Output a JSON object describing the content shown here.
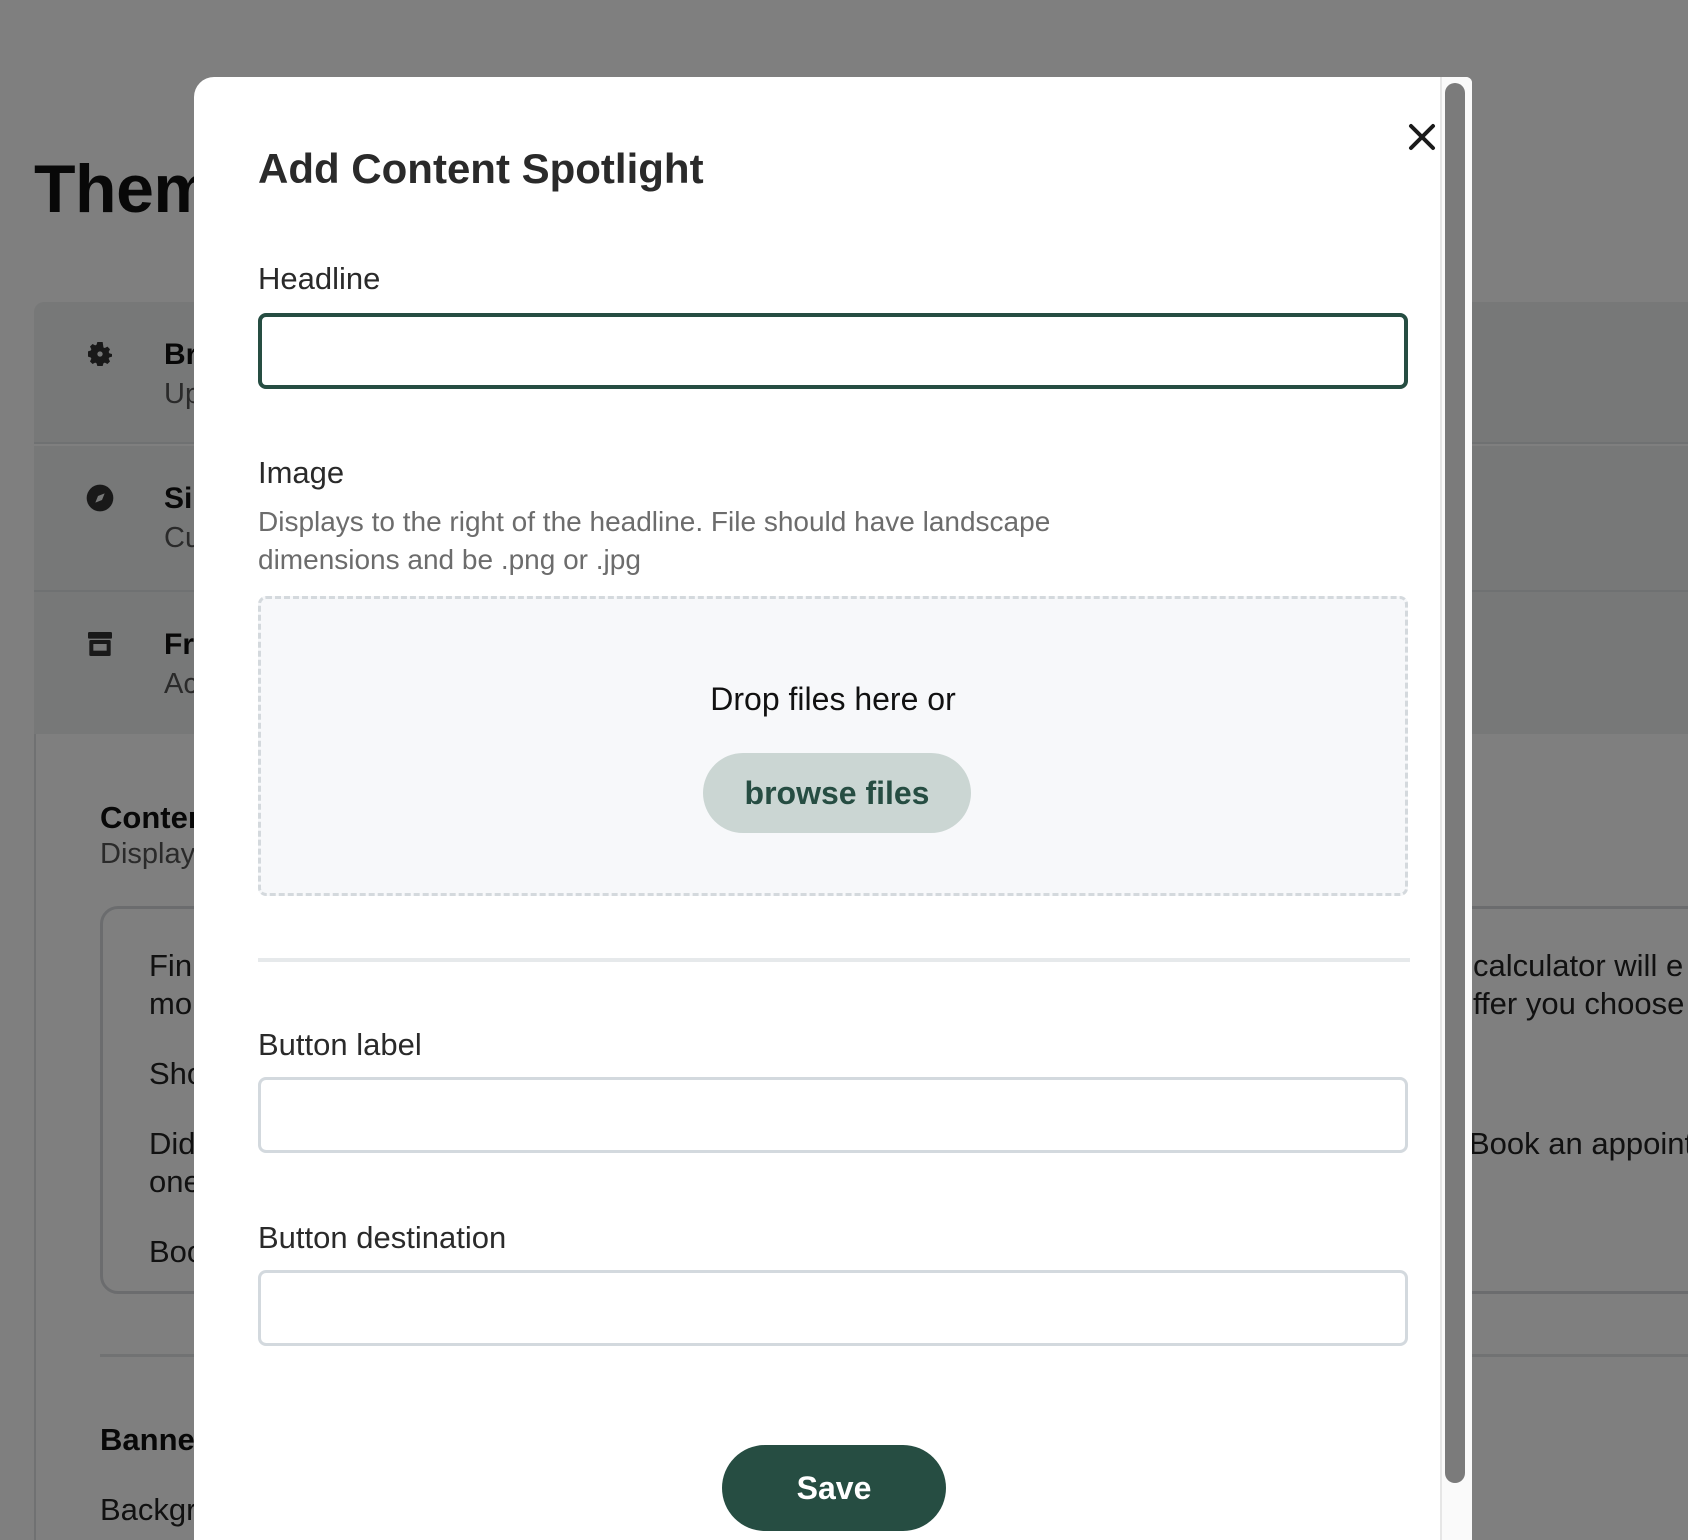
{
  "background": {
    "page_title": "Them",
    "sections": [
      {
        "icon": "gear-icon",
        "title": "Br",
        "subtitle": "Up"
      },
      {
        "icon": "compass-icon",
        "title": "Si",
        "subtitle": "Cu"
      },
      {
        "icon": "storefront-icon",
        "title": "Fr",
        "subtitle": "Ac"
      }
    ],
    "content_title": "Conter",
    "content_subtitle": "Display",
    "card_lines_left": [
      "Fin",
      "mo",
      "Sho",
      "Did",
      "one",
      "Boo"
    ],
    "card_lines_right": [
      "calculator will e",
      "ffer you choose",
      "Book an appoint"
    ],
    "banner_title": "Banner",
    "background_label": "Backgr"
  },
  "modal": {
    "title": "Add Content Spotlight",
    "close_icon": "close-icon",
    "headline": {
      "label": "Headline",
      "value": "",
      "placeholder": ""
    },
    "image": {
      "label": "Image",
      "help": "Displays to the right of the headline. File should have landscape dimensions and be .png or .jpg",
      "drop_text": "Drop files here or",
      "browse_label": "browse files"
    },
    "button_label": {
      "label": "Button label",
      "value": "",
      "placeholder": ""
    },
    "button_destination": {
      "label": "Button destination",
      "value": "",
      "placeholder": ""
    },
    "save_label": "Save"
  },
  "colors": {
    "primary": "#264d42",
    "primary_light": "#cbd6d3",
    "overlay": "rgba(0,0,0,0.5)"
  }
}
